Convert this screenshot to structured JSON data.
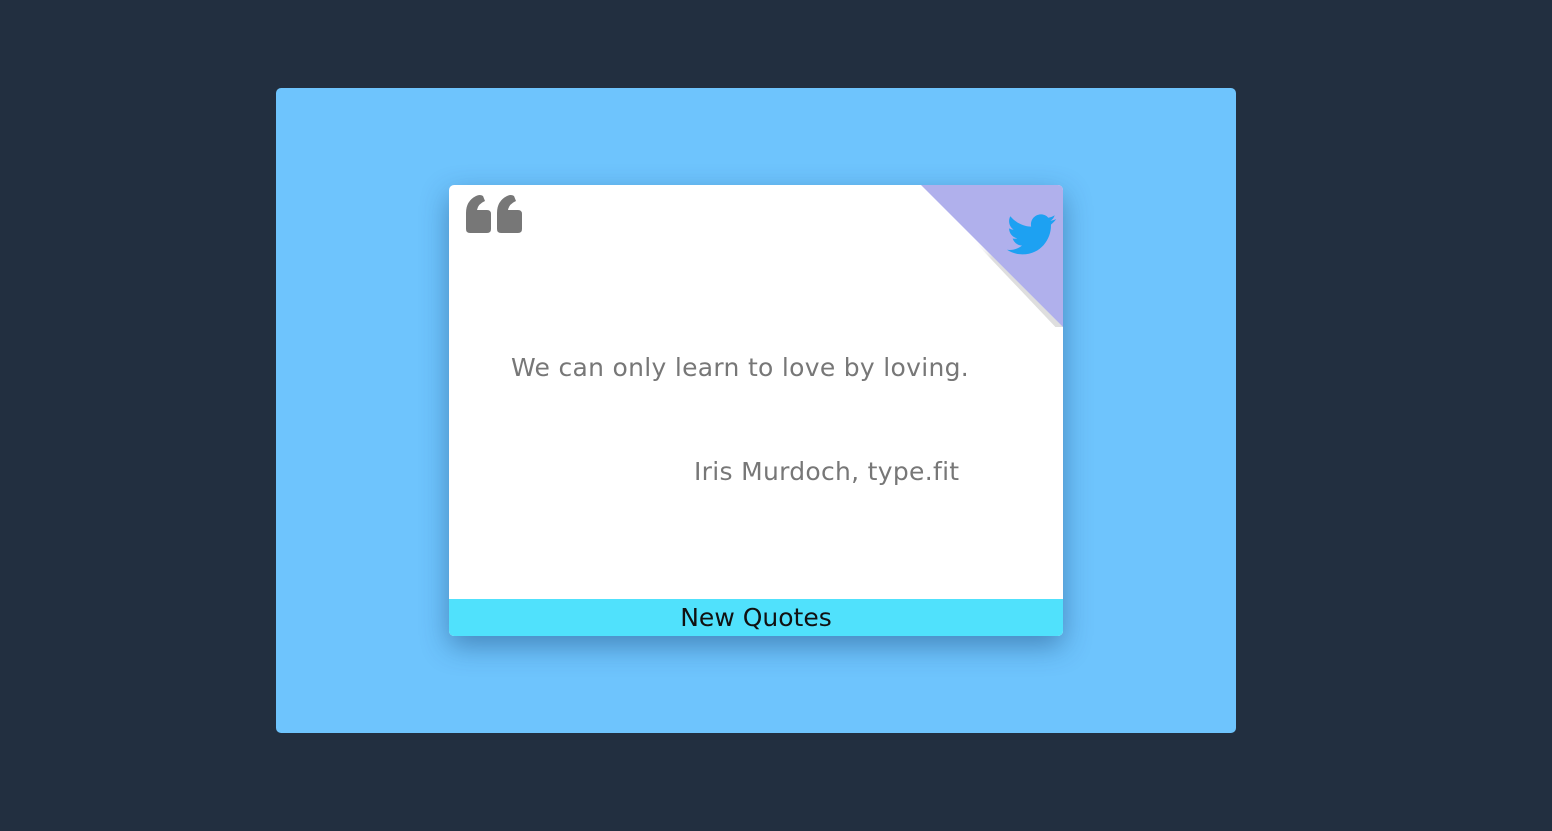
{
  "quote": {
    "text": "We can only learn to love by loving.",
    "attribution": "Iris Murdoch, type.fit"
  },
  "actions": {
    "new_quote_label": "New Quotes",
    "tweet_icon": "twitter-bird-icon"
  },
  "icons": {
    "quote_mark": "quote-icon",
    "tweet": "twitter-icon"
  },
  "colors": {
    "page_background": "#222f40",
    "stage_background": "#6ec4fd",
    "card_background": "#ffffff",
    "corner_fold": "#b0b0ec",
    "twitter_blue": "#1da1f2",
    "button_background": "#50e1fc",
    "quote_text": "#777777"
  }
}
